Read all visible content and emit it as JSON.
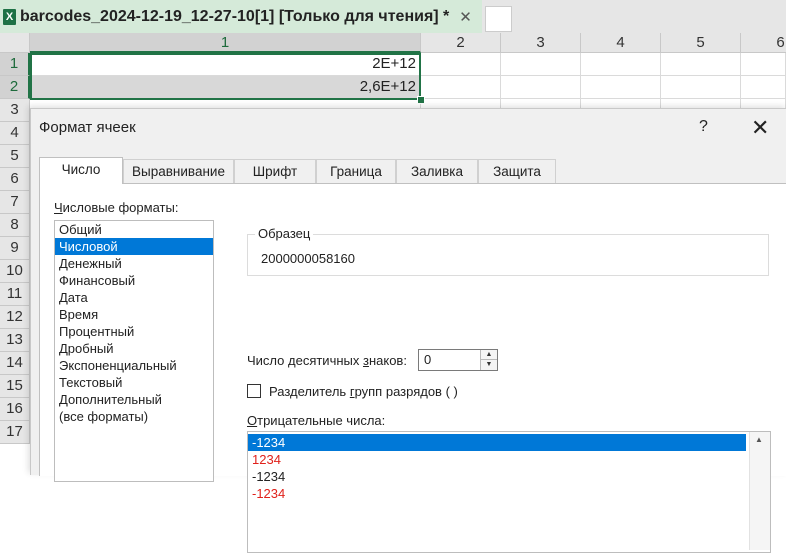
{
  "window": {
    "file_tab_label": "barcodes_2024-12-19_12-27-10[1]  [Только для чтения] *",
    "file_tab_close": "✕",
    "excel_icon_glyph": "X"
  },
  "sheet": {
    "columns": [
      "1",
      "2",
      "3",
      "4",
      "5",
      "6"
    ],
    "rows": [
      "1",
      "2",
      "3",
      "4",
      "5",
      "6",
      "7",
      "8",
      "9",
      "10",
      "11",
      "12",
      "13",
      "14",
      "15",
      "16",
      "17"
    ],
    "cell_a1": "2E+12",
    "cell_a2": "2,6E+12",
    "accent_color": "#217346"
  },
  "dialog": {
    "title": "Формат ячеек",
    "help": "?",
    "close": "✕",
    "tabs": [
      "Число",
      "Выравнивание",
      "Шрифт",
      "Граница",
      "Заливка",
      "Защита"
    ],
    "active_tab": "Число",
    "formats_label_first": "Ч",
    "formats_label_rest": "исловые форматы:",
    "formats": [
      "Общий",
      "Числовой",
      "Денежный",
      "Финансовый",
      "Дата",
      "Время",
      "Процентный",
      "Дробный",
      "Экспоненциальный",
      "Текстовый",
      "Дополнительный",
      "(все форматы)"
    ],
    "selected_format": "Числовой",
    "sample_label": "Образец",
    "sample_value": "2000000058160",
    "decimals_label_pre": "Число десятичных ",
    "decimals_label_u": "з",
    "decimals_label_post": "наков:",
    "decimals_value": "0",
    "separator_pre": "Разделитель ",
    "separator_u": "г",
    "separator_post": "рупп разрядов ( )",
    "separator_checked": false,
    "negative_label_u": "О",
    "negative_label_rest": "трицательные числа:",
    "negative_numbers": [
      {
        "text": "-1234",
        "color": "#ffffff",
        "selected": true
      },
      {
        "text": "1234",
        "color": "#e0211b",
        "selected": false
      },
      {
        "text": "-1234",
        "color": "#222222",
        "selected": false
      },
      {
        "text": "-1234",
        "color": "#e0211b",
        "selected": false
      }
    ],
    "selection_color": "#0078d7"
  }
}
